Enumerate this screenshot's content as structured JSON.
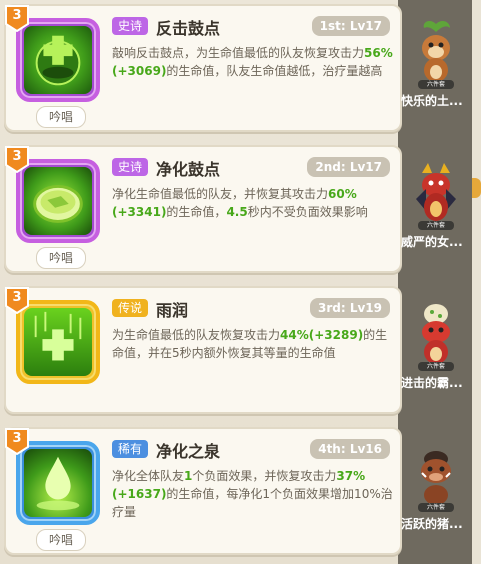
{
  "skills": [
    {
      "level": "3",
      "rarity": "史诗",
      "name": "反击鼓点",
      "rank": "1st: Lv17",
      "cast": "吟唱",
      "desc_parts": [
        "敲响反击鼓点，为生命值最低的队友恢复攻击力",
        "56%",
        "(+3069)",
        "的生命值，队友生命值越低，治疗量越高"
      ],
      "hero_name": "快乐的土...",
      "hero_icon": "happy-earth-hero-icon"
    },
    {
      "level": "3",
      "rarity": "史诗",
      "name": "净化鼓点",
      "rank": "2nd: Lv17",
      "cast": "吟唱",
      "desc_parts": [
        "净化生命值最低的队友，并恢复其攻击力",
        "60%",
        "(+3341)",
        "的生命值，",
        "4.5",
        "秒内不受负面效果影响"
      ],
      "hero_name": "威严的女...",
      "hero_icon": "majestic-dragon-hero-icon"
    },
    {
      "level": "3",
      "rarity": "传说",
      "name": "雨润",
      "rank": "3rd: Lv19",
      "cast": "",
      "desc_parts": [
        "为生命值最低的队友恢复攻击力",
        "44%",
        "(+3289)",
        "的生命值，并在5秒内额外恢复其等量的生命值"
      ],
      "hero_name": "进击的霸...",
      "hero_icon": "attack-dino-hero-icon"
    },
    {
      "level": "3",
      "rarity": "稀有",
      "name": "净化之泉",
      "rank": "4th: Lv16",
      "cast": "吟唱",
      "desc_parts": [
        "净化全体队友",
        "1",
        "个负面效果，并恢复攻击力",
        "37%",
        "(+1637)",
        "的生命值，每净化1个负面效果增加10%治疗量"
      ],
      "hero_name": "活跃的猪...",
      "hero_icon": "active-boar-hero-icon"
    }
  ],
  "pedestal_label": "六件套",
  "colors": {
    "highlight": "#48a81a",
    "epic": "#bd66e6",
    "legend": "#f0b21f",
    "rare": "#4c8fe0"
  }
}
